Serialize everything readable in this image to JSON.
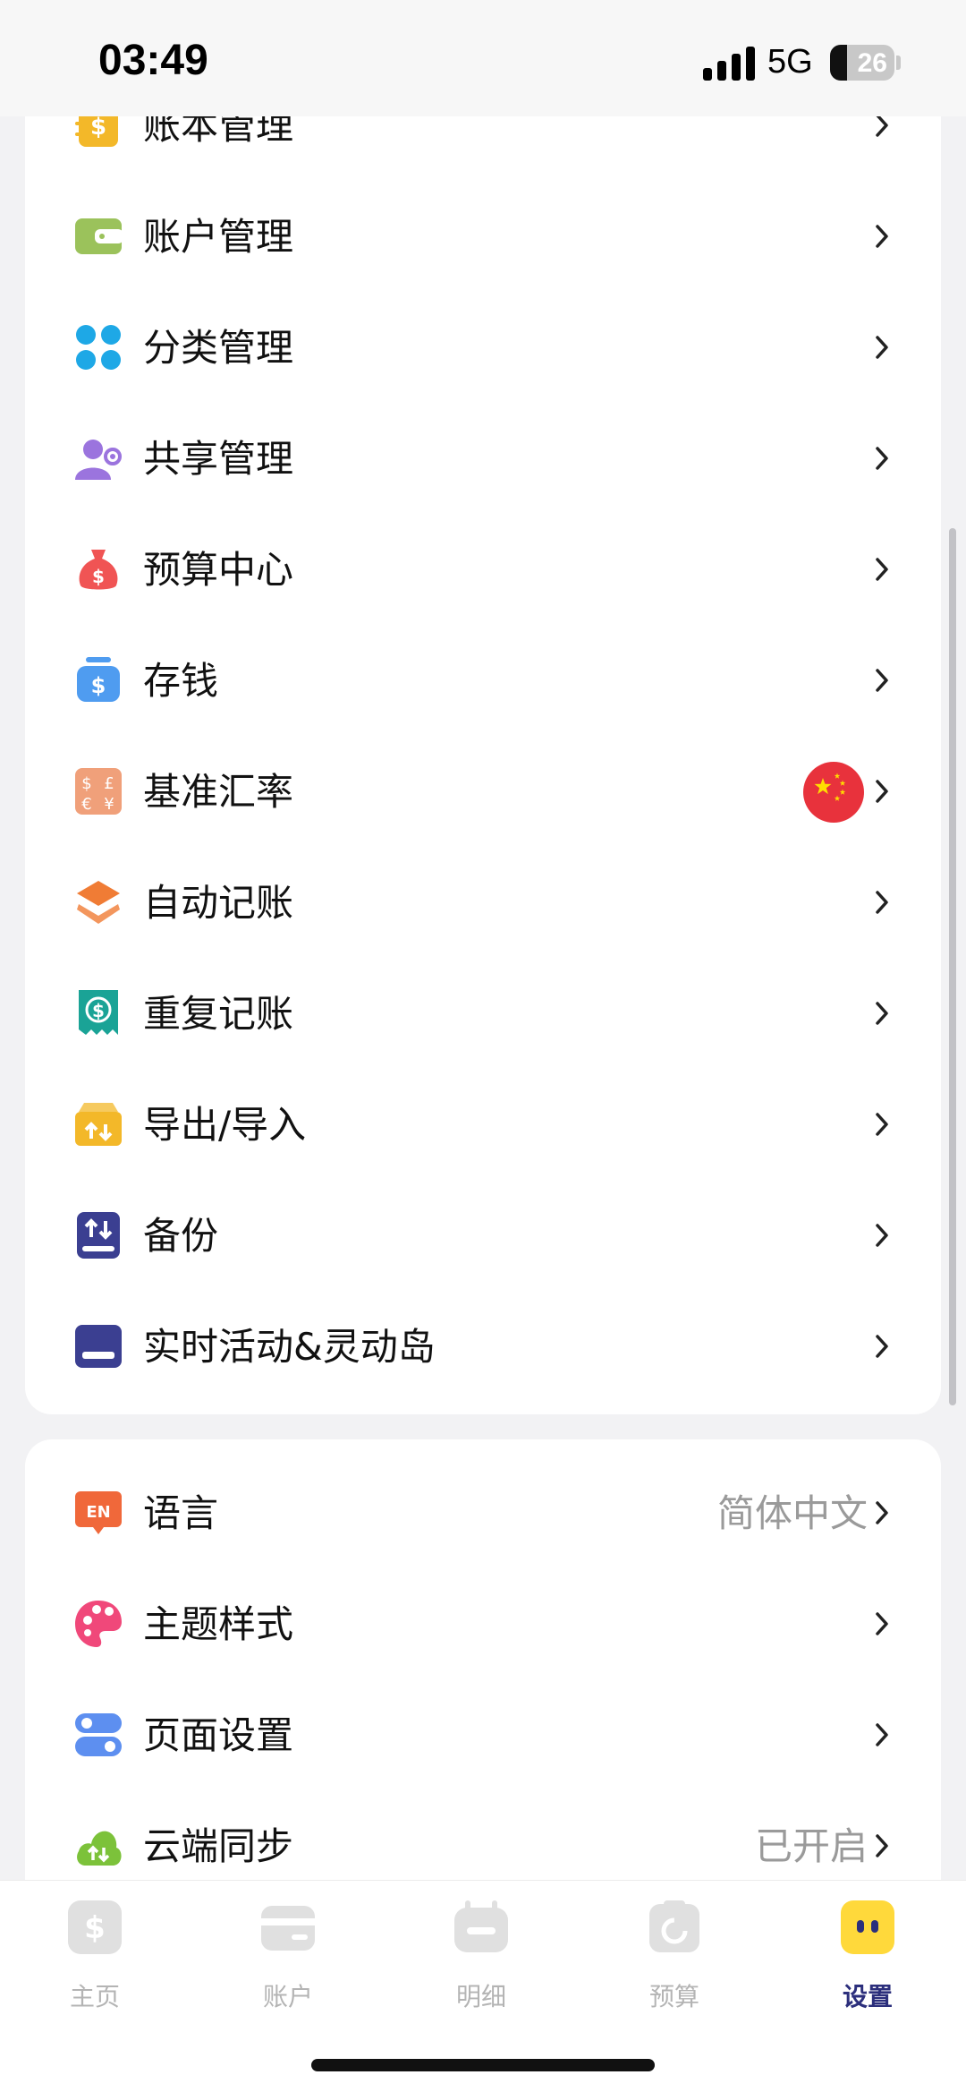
{
  "status_bar": {
    "time": "03:49",
    "network": "5G",
    "battery_level": "26",
    "battery_fraction": 0.26
  },
  "settings_section_1": {
    "items": [
      {
        "label": "账本管理",
        "icon": "ledger-icon",
        "color": "#f3b829"
      },
      {
        "label": "账户管理",
        "icon": "wallet-icon",
        "color": "#9bc25b"
      },
      {
        "label": "分类管理",
        "icon": "category-grid-icon",
        "color": "#1ea8e6"
      },
      {
        "label": "共享管理",
        "icon": "shared-users-icon",
        "color": "#9b74de"
      },
      {
        "label": "预算中心",
        "icon": "money-bag-icon",
        "color": "#f05454"
      },
      {
        "label": "存钱",
        "icon": "savings-jar-icon",
        "color": "#4f9cf0"
      },
      {
        "label": "基准汇率",
        "icon": "currency-exchange-icon",
        "color": "#f0a07a",
        "badge": "china-flag-icon"
      },
      {
        "label": "自动记账",
        "icon": "layers-icon",
        "color": "#f07c35"
      },
      {
        "label": "重复记账",
        "icon": "recurring-receipt-icon",
        "color": "#1aa396"
      },
      {
        "label": "导出/导入",
        "icon": "import-export-box-icon",
        "color": "#f3b829"
      },
      {
        "label": "备份",
        "icon": "backup-drive-icon",
        "color": "#3b3f91"
      },
      {
        "label": "实时活动&灵动岛",
        "icon": "live-activity-icon",
        "color": "#3b3f91"
      }
    ]
  },
  "settings_section_2": {
    "items": [
      {
        "label": "语言",
        "value": "简体中文",
        "icon": "language-en-icon",
        "color": "#f0683a"
      },
      {
        "label": "主题样式",
        "value": "",
        "icon": "palette-icon",
        "color": "#f0487a"
      },
      {
        "label": "页面设置",
        "value": "",
        "icon": "toggle-settings-icon",
        "color": "#5d8ff0"
      },
      {
        "label": "云端同步",
        "value": "已开启",
        "icon": "cloud-sync-icon",
        "color": "#7cc23a"
      }
    ]
  },
  "tabbar": {
    "tabs": [
      {
        "label": "主页",
        "icon": "home-dollar-icon"
      },
      {
        "label": "账户",
        "icon": "account-card-icon"
      },
      {
        "label": "明细",
        "icon": "details-calendar-icon"
      },
      {
        "label": "预算",
        "icon": "budget-clipboard-icon"
      },
      {
        "label": "设置",
        "icon": "settings-face-icon"
      }
    ],
    "active_index": 4,
    "active_color": "#ffd93b"
  }
}
